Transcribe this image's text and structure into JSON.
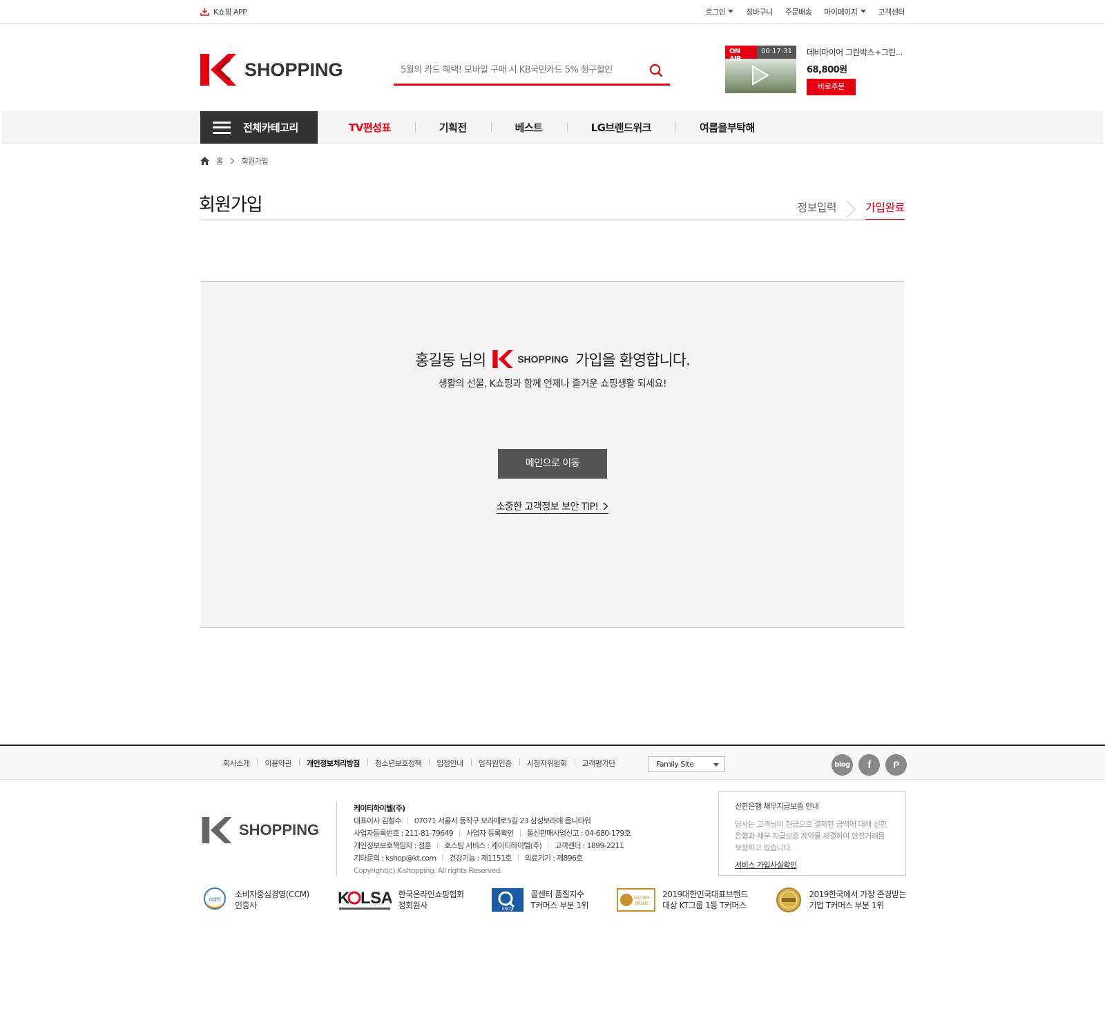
{
  "topbar": {
    "app_label": "K쇼핑 APP",
    "login": "로그인",
    "cart": "장바구니",
    "order_delivery": "주문배송",
    "mypage": "마이페이지",
    "customer_center": "고객센터"
  },
  "header": {
    "logo_text": "SHOPPING",
    "search_placeholder": "5월의 카드 혜택! 모바일 구매 시 KB국민카드 5% 청구할인",
    "onair_label": "ON AIR",
    "onair_time": "00:17:31",
    "product_name": "데비마이어 그린박스+그린...",
    "product_price": "68,800원",
    "buy_now": "바로주문"
  },
  "gnb": {
    "all_categories": "전체카테고리",
    "items": [
      "TV편성표",
      "기획전",
      "베스트",
      "LG브랜드위크",
      "여름을부탁해"
    ]
  },
  "breadcrumb": {
    "home": "홈",
    "current": "회원가입"
  },
  "page": {
    "title": "회원가입",
    "step1": "정보입력",
    "step2": "가입완료"
  },
  "welcome": {
    "name_prefix": "홍길동 님의",
    "logo_text": "SHOPPING",
    "suffix": "가입을 환영합니다.",
    "subtitle": "생활의 선물, K쇼핑과 함께 언제나 즐거운 쇼핑생활 되세요!",
    "main_button": "메인으로 이동",
    "tip_link": "소중한 고객정보 보안 TIP!"
  },
  "footer": {
    "links": [
      "회사소개",
      "이용약관",
      "개인정보처리방침",
      "청소년보호정책",
      "입점안내",
      "임직원인증",
      "시청자위원회",
      "고객평가단"
    ],
    "family_site": "Family Site",
    "sns": [
      "blog",
      "f",
      "P"
    ],
    "logo_text": "SHOPPING",
    "company": "케이티하이텔(주)",
    "ceo": "대표이사 김철수",
    "address": "07071 서울시 동작구 보라매로5길 23 삼성보라매 옴니타워",
    "biz_no": "사업자등록번호 : 211-81-79649",
    "biz_check": "사업자 등록확인",
    "mail_order": "통신판매사업신고 : 04-680-179호",
    "privacy_officer": "개인정보보호책임자 : 정훈",
    "hosting": "호스팅 서비스 : 케이티하이텔(주)",
    "cs_center": "고객센터 : 1899-2211",
    "other_inquiry": "기타문의 : kshop@kt.com",
    "health_func": "건강기능 : 제1151호",
    "medical": "의료기기 : 제896호",
    "copyright": "Copyright(c) K-shopping. All rights Reserved.",
    "guarantee_title": "신한은행 채무지급보증 안내",
    "guarantee_desc": "당사는 고객님이 현금으로 결제한 금액에 대해 신한은행과 채무 지급보증 계약을 체결하여 안전거래를 보장하고 있습니다.",
    "guarantee_link": "서비스 가입사실확인",
    "awards": [
      {
        "line1": "소비자중심경영(CCM)",
        "line2": "인증사"
      },
      {
        "line1": "한국온라인쇼핑협회",
        "line2": "정회원사"
      },
      {
        "line1": "콜센터 품질지수",
        "line2": "T커머스 부분 1위"
      },
      {
        "line1": "2019대한민국대표브랜드",
        "line2": "대상 KT그룹 1등 T커머스"
      },
      {
        "line1": "2019한국에서 가장 존경받는",
        "line2": "기업 T커머스 부분 1위"
      }
    ]
  },
  "colors": {
    "accent": "#e60012",
    "dark": "#333333"
  }
}
